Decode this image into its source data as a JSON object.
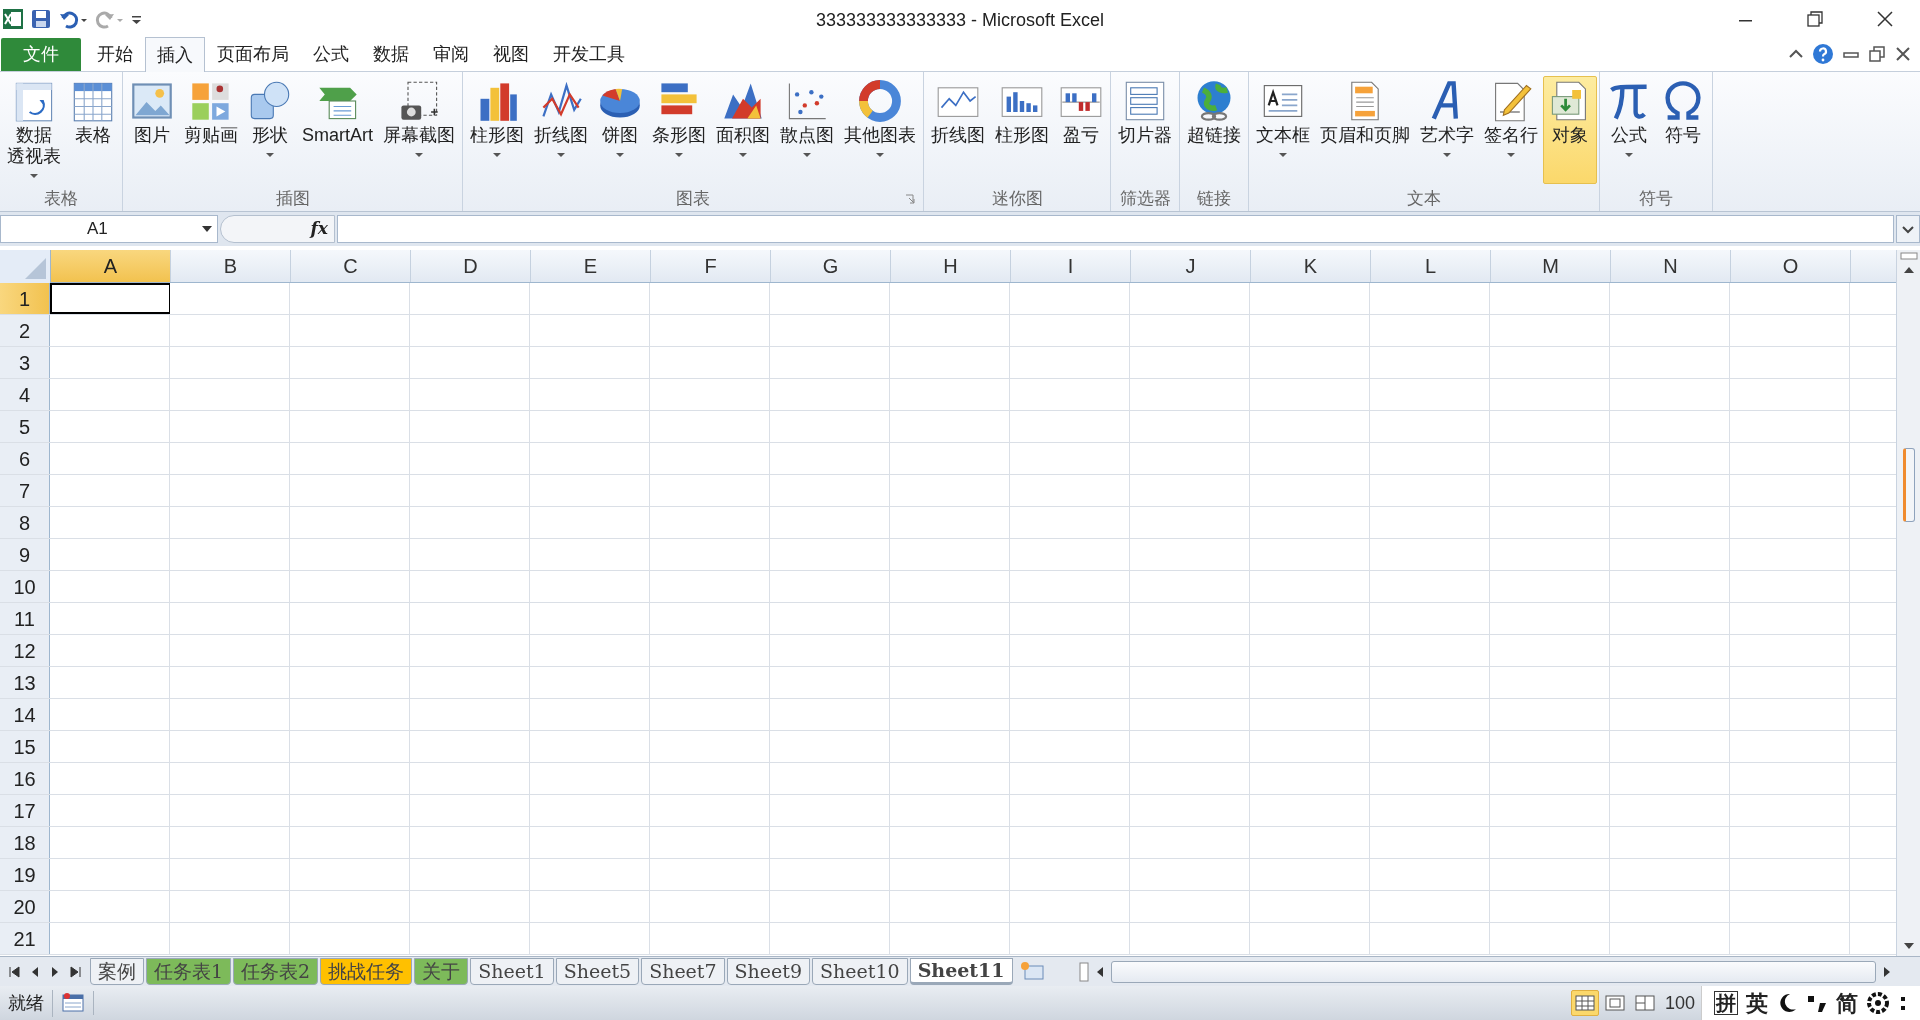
{
  "window": {
    "title": "333333333333333 - Microsoft Excel"
  },
  "ribbon_tabs": [
    {
      "label": "文件",
      "kind": "file",
      "selected": false
    },
    {
      "label": "开始",
      "kind": "tab",
      "selected": false
    },
    {
      "label": "插入",
      "kind": "tab",
      "selected": true
    },
    {
      "label": "页面布局",
      "kind": "tab",
      "selected": false
    },
    {
      "label": "公式",
      "kind": "tab",
      "selected": false
    },
    {
      "label": "数据",
      "kind": "tab",
      "selected": false
    },
    {
      "label": "审阅",
      "kind": "tab",
      "selected": false
    },
    {
      "label": "视图",
      "kind": "tab",
      "selected": false
    },
    {
      "label": "开发工具",
      "kind": "tab",
      "selected": false
    }
  ],
  "ribbon_groups": [
    {
      "label": "表格",
      "launcher": false,
      "buttons": [
        {
          "label_lines": [
            "数据",
            "透视表"
          ],
          "dropdown": true,
          "highlighted": false
        },
        {
          "label_lines": [
            "表格"
          ],
          "dropdown": false,
          "highlighted": false
        }
      ]
    },
    {
      "label": "插图",
      "launcher": false,
      "buttons": [
        {
          "label_lines": [
            "图片"
          ],
          "dropdown": false,
          "highlighted": false
        },
        {
          "label_lines": [
            "剪贴画"
          ],
          "dropdown": false,
          "highlighted": false
        },
        {
          "label_lines": [
            "形状"
          ],
          "dropdown": true,
          "highlighted": false
        },
        {
          "label_lines": [
            "SmartArt"
          ],
          "dropdown": false,
          "highlighted": false
        },
        {
          "label_lines": [
            "屏幕截图"
          ],
          "dropdown": true,
          "highlighted": false
        }
      ]
    },
    {
      "label": "图表",
      "launcher": true,
      "buttons": [
        {
          "label_lines": [
            "柱形图"
          ],
          "dropdown": true,
          "highlighted": false
        },
        {
          "label_lines": [
            "折线图"
          ],
          "dropdown": true,
          "highlighted": false
        },
        {
          "label_lines": [
            "饼图"
          ],
          "dropdown": true,
          "highlighted": false
        },
        {
          "label_lines": [
            "条形图"
          ],
          "dropdown": true,
          "highlighted": false
        },
        {
          "label_lines": [
            "面积图"
          ],
          "dropdown": true,
          "highlighted": false
        },
        {
          "label_lines": [
            "散点图"
          ],
          "dropdown": true,
          "highlighted": false
        },
        {
          "label_lines": [
            "其他图表"
          ],
          "dropdown": true,
          "highlighted": false
        }
      ]
    },
    {
      "label": "迷你图",
      "launcher": false,
      "buttons": [
        {
          "label_lines": [
            "折线图"
          ],
          "dropdown": false,
          "highlighted": false
        },
        {
          "label_lines": [
            "柱形图"
          ],
          "dropdown": false,
          "highlighted": false
        },
        {
          "label_lines": [
            "盈亏"
          ],
          "dropdown": false,
          "highlighted": false
        }
      ]
    },
    {
      "label": "筛选器",
      "launcher": false,
      "buttons": [
        {
          "label_lines": [
            "切片器"
          ],
          "dropdown": false,
          "highlighted": false
        }
      ]
    },
    {
      "label": "链接",
      "launcher": false,
      "buttons": [
        {
          "label_lines": [
            "超链接"
          ],
          "dropdown": false,
          "highlighted": false
        }
      ]
    },
    {
      "label": "文本",
      "launcher": false,
      "buttons": [
        {
          "label_lines": [
            "文本框"
          ],
          "dropdown": true,
          "highlighted": false
        },
        {
          "label_lines": [
            "页眉和页脚"
          ],
          "dropdown": false,
          "highlighted": false
        },
        {
          "label_lines": [
            "艺术字"
          ],
          "dropdown": true,
          "highlighted": false
        },
        {
          "label_lines": [
            "签名行"
          ],
          "dropdown": true,
          "highlighted": false
        },
        {
          "label_lines": [
            "对象"
          ],
          "dropdown": false,
          "highlighted": true
        }
      ]
    },
    {
      "label": "符号",
      "launcher": false,
      "buttons": [
        {
          "label_lines": [
            "公式"
          ],
          "dropdown": true,
          "highlighted": false
        },
        {
          "label_lines": [
            "符号"
          ],
          "dropdown": false,
          "highlighted": false
        }
      ]
    }
  ],
  "name_box": {
    "value": "A1"
  },
  "formula_bar": {
    "function_label": "fx"
  },
  "columns": [
    {
      "label": "A",
      "selected": true
    },
    {
      "label": "B",
      "selected": false
    },
    {
      "label": "C",
      "selected": false
    },
    {
      "label": "D",
      "selected": false
    },
    {
      "label": "E",
      "selected": false
    },
    {
      "label": "F",
      "selected": false
    },
    {
      "label": "G",
      "selected": false
    },
    {
      "label": "H",
      "selected": false
    },
    {
      "label": "I",
      "selected": false
    },
    {
      "label": "J",
      "selected": false
    },
    {
      "label": "K",
      "selected": false
    },
    {
      "label": "L",
      "selected": false
    },
    {
      "label": "M",
      "selected": false
    },
    {
      "label": "N",
      "selected": false
    },
    {
      "label": "O",
      "selected": false
    }
  ],
  "rows": [
    {
      "label": "1",
      "selected": true
    },
    {
      "label": "2",
      "selected": false
    },
    {
      "label": "3",
      "selected": false
    },
    {
      "label": "4",
      "selected": false
    },
    {
      "label": "5",
      "selected": false
    },
    {
      "label": "6",
      "selected": false
    },
    {
      "label": "7",
      "selected": false
    },
    {
      "label": "8",
      "selected": false
    },
    {
      "label": "9",
      "selected": false
    },
    {
      "label": "10",
      "selected": false
    },
    {
      "label": "11",
      "selected": false
    },
    {
      "label": "12",
      "selected": false
    },
    {
      "label": "13",
      "selected": false
    },
    {
      "label": "14",
      "selected": false
    },
    {
      "label": "15",
      "selected": false
    },
    {
      "label": "16",
      "selected": false
    },
    {
      "label": "17",
      "selected": false
    },
    {
      "label": "18",
      "selected": false
    },
    {
      "label": "19",
      "selected": false
    },
    {
      "label": "20",
      "selected": false
    },
    {
      "label": "21",
      "selected": false
    }
  ],
  "sheet_tabs": [
    {
      "label": "案例",
      "selected": false
    },
    {
      "label": "任务表1",
      "color": "#7dba5a",
      "selected": false
    },
    {
      "label": "任务表2",
      "color": "#7dba5a",
      "selected": false
    },
    {
      "label": "挑战任务",
      "color": "#ffc000",
      "selected": false
    },
    {
      "label": "关于",
      "color": "#7dba5a",
      "selected": false
    },
    {
      "label": "Sheet1",
      "selected": false
    },
    {
      "label": "Sheet5",
      "selected": false
    },
    {
      "label": "Sheet7",
      "selected": false
    },
    {
      "label": "Sheet9",
      "selected": false
    },
    {
      "label": "Sheet10",
      "selected": false
    },
    {
      "label": "Sheet11",
      "selected": true
    }
  ],
  "status_bar": {
    "text": "就绪",
    "views": [
      {
        "selected": true
      },
      {
        "selected": false
      },
      {
        "selected": false
      }
    ],
    "zoom": "100"
  },
  "ime_bar": {
    "items": [
      {
        "kind": "boxed",
        "text": "拼"
      },
      {
        "kind": "text",
        "text": "英"
      },
      {
        "kind": "moon"
      },
      {
        "kind": "punct"
      },
      {
        "kind": "text",
        "text": "简"
      },
      {
        "kind": "gear"
      },
      {
        "kind": "menu"
      }
    ]
  }
}
